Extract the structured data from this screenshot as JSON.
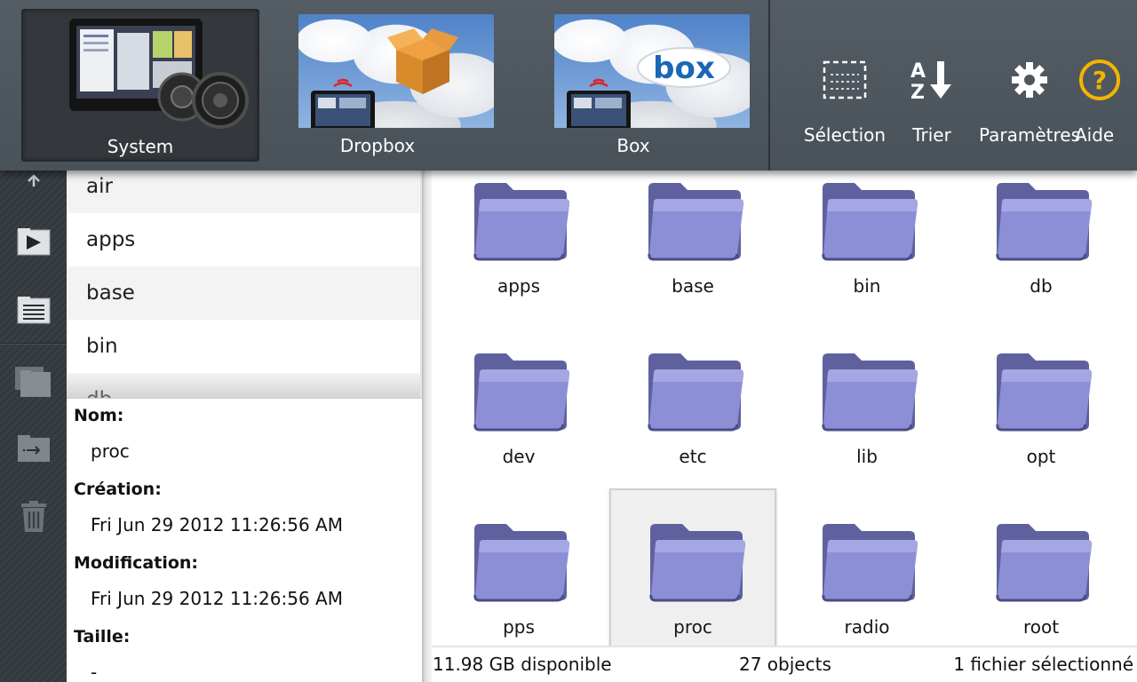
{
  "locations": [
    {
      "label": "System",
      "selected": true,
      "thumb": "playbook-gears-image"
    },
    {
      "label": "Dropbox",
      "selected": false,
      "thumb": "dropbox-cloud-image"
    },
    {
      "label": "Box",
      "selected": false,
      "thumb": "box-cloud-image"
    }
  ],
  "actions": {
    "selection": {
      "label": "Sélection",
      "icon": "selection-icon"
    },
    "sort": {
      "label": "Trier",
      "icon": "sort-az-icon"
    },
    "settings": {
      "label": "Paramètres",
      "icon": "gear-icon"
    },
    "help": {
      "label": "Aide",
      "icon": "help-icon"
    }
  },
  "left_toolbar": [
    "upload-icon",
    "play-icon",
    "list-icon",
    "copy-icon",
    "move-icon",
    "trash-icon"
  ],
  "folder_list": [
    "air",
    "apps",
    "base",
    "bin",
    "db"
  ],
  "details": {
    "name_label": "Nom:",
    "name_value": "proc",
    "created_label": "Création:",
    "created_value": "Fri Jun 29 2012 11:26:56 AM",
    "modified_label": "Modification:",
    "modified_value": "Fri Jun 29 2012 11:26:56 AM",
    "size_label": "Taille:",
    "size_value": "-"
  },
  "grid": {
    "items": [
      "apps",
      "base",
      "bin",
      "db",
      "dev",
      "etc",
      "lib",
      "opt",
      "pps",
      "proc",
      "radio",
      "root"
    ],
    "selected": "proc"
  },
  "status": {
    "free": "11.98 GB disponible",
    "count": "27 objects",
    "selection": "1 fichier sélectionné"
  },
  "colors": {
    "toolbar": "#4f575e",
    "folder": "#7c7fc4",
    "help_accent": "#f4b400"
  }
}
